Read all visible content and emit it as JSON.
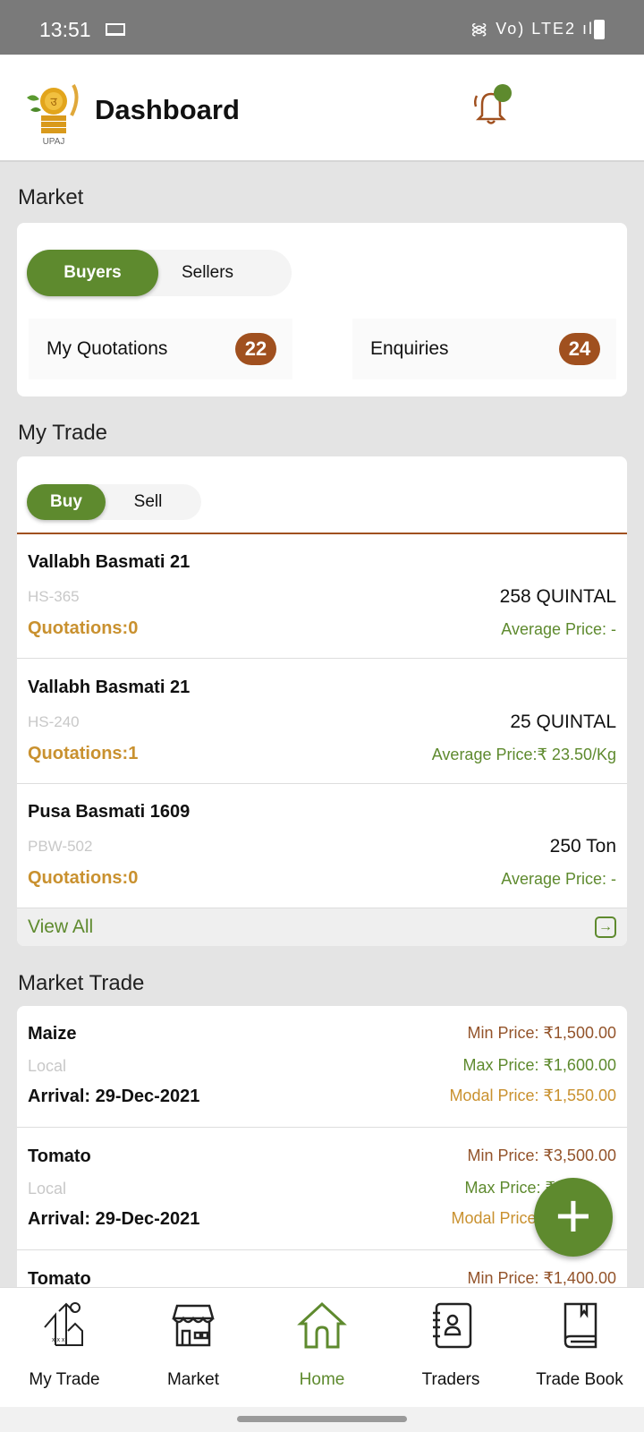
{
  "status_bar": {
    "time": "13:51",
    "indicators": "Vo) LTE2"
  },
  "header": {
    "title": "Dashboard",
    "logo_text": "UPAJ",
    "notification_icon": "bell-icon"
  },
  "market": {
    "title": "Market",
    "toggle": [
      "Buyers",
      "Sellers"
    ],
    "selected": "Buyers",
    "stats": [
      {
        "label": "My Quotations",
        "count": "22"
      },
      {
        "label": "Enquiries",
        "count": "24"
      }
    ]
  },
  "my_trade": {
    "title": "My Trade",
    "toggle": [
      "Buy",
      "Sell"
    ],
    "selected": "Buy",
    "items": [
      {
        "name": "Vallabh Basmati 21",
        "code": "HS-365",
        "quantity": "258 QUINTAL",
        "quotations": "Quotations:0",
        "avg_price": "Average Price: -"
      },
      {
        "name": "Vallabh Basmati 21",
        "code": "HS-240",
        "quantity": "25 QUINTAL",
        "quotations": "Quotations:1",
        "avg_price": "Average Price:₹ 23.50/Kg"
      },
      {
        "name": "Pusa Basmati 1609",
        "code": "PBW-502",
        "quantity": "250 Ton",
        "quotations": "Quotations:0",
        "avg_price": "Average Price: -"
      }
    ],
    "view_all": "View All"
  },
  "market_trade": {
    "title": "Market Trade",
    "items": [
      {
        "name": "Maize",
        "location": "Local",
        "arrival": "Arrival: 29-Dec-2021",
        "min": "Min Price: ₹1,500.00",
        "max": "Max Price: ₹1,600.00",
        "modal": "Modal Price: ₹1,550.00"
      },
      {
        "name": "Tomato",
        "location": "Local",
        "arrival": "Arrival: 29-Dec-2021",
        "min": "Min Price: ₹3,500.00",
        "max": "Max Price: ₹",
        "modal": "Modal Price: ₹"
      },
      {
        "name": "Tomato",
        "min": "Min Price: ₹1,400.00"
      }
    ]
  },
  "bottom_nav": [
    {
      "label": "My Trade",
      "icon": "trade-house-icon"
    },
    {
      "label": "Market",
      "icon": "shop-icon"
    },
    {
      "label": "Home",
      "icon": "home-icon",
      "active": true
    },
    {
      "label": "Traders",
      "icon": "contacts-book-icon"
    },
    {
      "label": "Trade Book",
      "icon": "book-icon"
    }
  ],
  "colors": {
    "accent": "#5e8a2e",
    "badge": "#a0501f",
    "quotations": "#c9912f",
    "min_price": "#93532a"
  }
}
